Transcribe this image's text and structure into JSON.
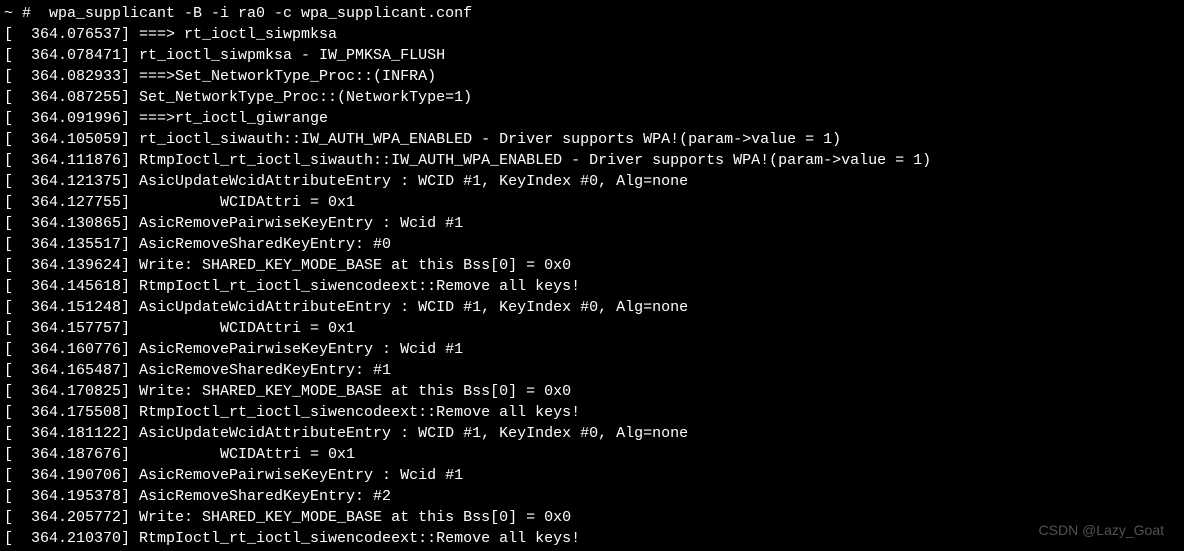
{
  "terminal": {
    "prompt": "~ #  wpa_supplicant -B -i ra0 -c wpa_supplicant.conf",
    "lines": [
      "[  364.076537] ===> rt_ioctl_siwpmksa",
      "[  364.078471] rt_ioctl_siwpmksa - IW_PMKSA_FLUSH",
      "[  364.082933] ===>Set_NetworkType_Proc::(INFRA)",
      "[  364.087255] Set_NetworkType_Proc::(NetworkType=1)",
      "[  364.091996] ===>rt_ioctl_giwrange",
      "[  364.105059] rt_ioctl_siwauth::IW_AUTH_WPA_ENABLED - Driver supports WPA!(param->value = 1)",
      "[  364.111876] RtmpIoctl_rt_ioctl_siwauth::IW_AUTH_WPA_ENABLED - Driver supports WPA!(param->value = 1)",
      "[  364.121375] AsicUpdateWcidAttributeEntry : WCID #1, KeyIndex #0, Alg=none",
      "[  364.127755]          WCIDAttri = 0x1",
      "[  364.130865] AsicRemovePairwiseKeyEntry : Wcid #1",
      "[  364.135517] AsicRemoveSharedKeyEntry: #0",
      "[  364.139624] Write: SHARED_KEY_MODE_BASE at this Bss[0] = 0x0",
      "[  364.145618] RtmpIoctl_rt_ioctl_siwencodeext::Remove all keys!",
      "[  364.151248] AsicUpdateWcidAttributeEntry : WCID #1, KeyIndex #0, Alg=none",
      "[  364.157757]          WCIDAttri = 0x1",
      "[  364.160776] AsicRemovePairwiseKeyEntry : Wcid #1",
      "[  364.165487] AsicRemoveSharedKeyEntry: #1",
      "[  364.170825] Write: SHARED_KEY_MODE_BASE at this Bss[0] = 0x0",
      "[  364.175508] RtmpIoctl_rt_ioctl_siwencodeext::Remove all keys!",
      "[  364.181122] AsicUpdateWcidAttributeEntry : WCID #1, KeyIndex #0, Alg=none",
      "[  364.187676]          WCIDAttri = 0x1",
      "[  364.190706] AsicRemovePairwiseKeyEntry : Wcid #1",
      "[  364.195378] AsicRemoveSharedKeyEntry: #2",
      "[  364.205772] Write: SHARED_KEY_MODE_BASE at this Bss[0] = 0x0",
      "[  364.210370] RtmpIoctl_rt_ioctl_siwencodeext::Remove all keys!"
    ]
  },
  "watermark": "CSDN @Lazy_Goat"
}
